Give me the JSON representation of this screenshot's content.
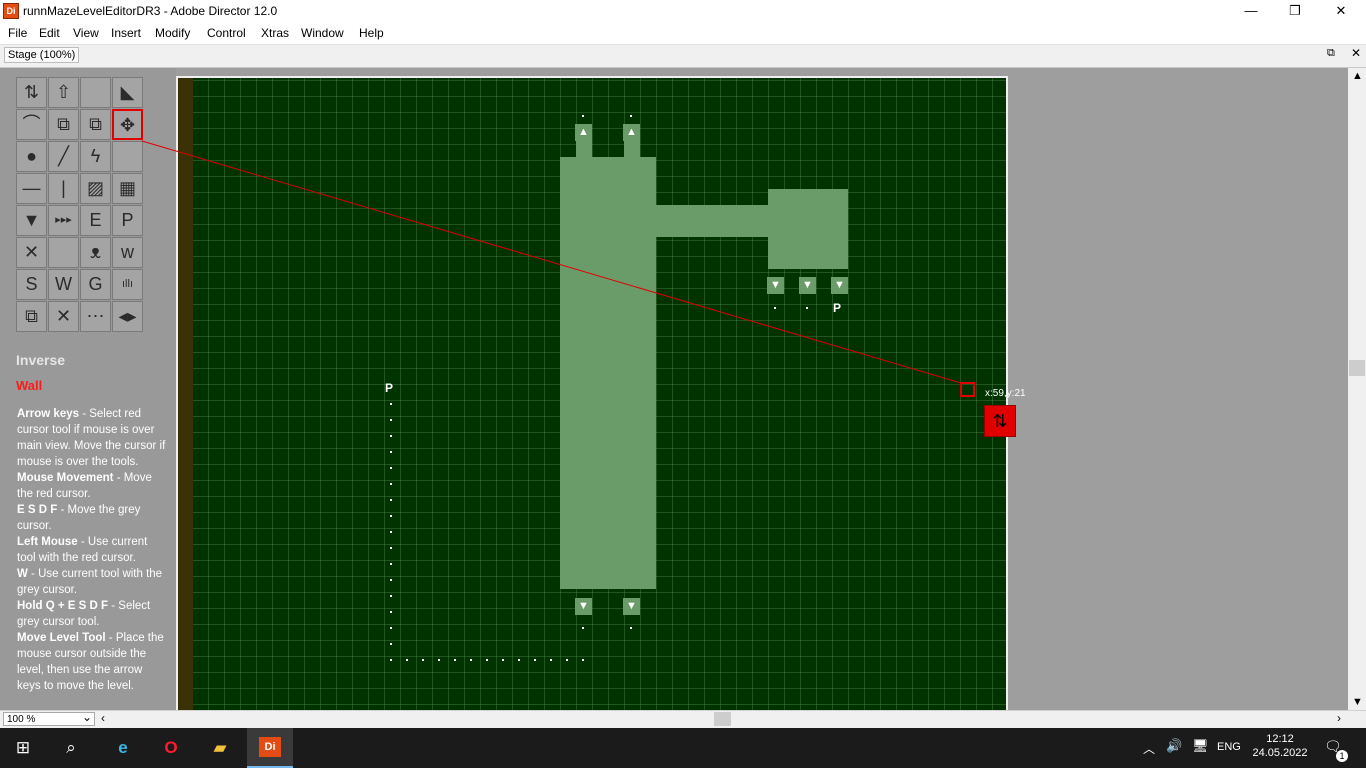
{
  "window": {
    "title": "runnMazeLevelEditorDR3 - Adobe Director 12.0",
    "app_icon_text": "Di",
    "controls": {
      "minimize": "—",
      "maximize": "❐",
      "close": "✕"
    }
  },
  "menu": [
    "File",
    "Edit",
    "View",
    "Insert",
    "Modify",
    "Control",
    "Xtras",
    "Window",
    "Help"
  ],
  "stage_tab": {
    "label": "Stage (100%)"
  },
  "tools": [
    {
      "name": "move-down-tool",
      "glyph": "⇅"
    },
    {
      "name": "move-up-tool",
      "glyph": "⇧"
    },
    {
      "name": "empty-tool",
      "glyph": ""
    },
    {
      "name": "ramp-tool",
      "glyph": "◣"
    },
    {
      "name": "ceiling-tool",
      "glyph": "⌒"
    },
    {
      "name": "copy-tool",
      "glyph": "⧉"
    },
    {
      "name": "duplicate-tool",
      "glyph": "⧉"
    },
    {
      "name": "move-level-tool",
      "glyph": "✥"
    },
    {
      "name": "ball-tool",
      "glyph": "●"
    },
    {
      "name": "line-tool",
      "glyph": "╱"
    },
    {
      "name": "lightning-tool",
      "glyph": "ϟ"
    },
    {
      "name": "blank-tool",
      "glyph": ""
    },
    {
      "name": "horizontal-tool",
      "glyph": "—"
    },
    {
      "name": "vertical-tool",
      "glyph": "|"
    },
    {
      "name": "slope-tool",
      "glyph": "▨"
    },
    {
      "name": "gallery-tool",
      "glyph": "▦"
    },
    {
      "name": "spike-tool",
      "glyph": "▼"
    },
    {
      "name": "dots-tool",
      "glyph": "▸▸▸"
    },
    {
      "name": "e-tool",
      "glyph": "E"
    },
    {
      "name": "p-tool",
      "glyph": "P"
    },
    {
      "name": "bird-left-tool",
      "glyph": "✕"
    },
    {
      "name": "blank-tool-2",
      "glyph": ""
    },
    {
      "name": "bird-tool",
      "glyph": "ᴥ"
    },
    {
      "name": "w-small-tool",
      "glyph": "w"
    },
    {
      "name": "s-tool",
      "glyph": "S"
    },
    {
      "name": "w-tool",
      "glyph": "W"
    },
    {
      "name": "g-tool",
      "glyph": "G"
    },
    {
      "name": "grass-tool",
      "glyph": "ıllı"
    },
    {
      "name": "layers-tool",
      "glyph": "⧉"
    },
    {
      "name": "cross-tool",
      "glyph": "✕"
    },
    {
      "name": "connect-tool",
      "glyph": "⋯"
    },
    {
      "name": "arrows-tool",
      "glyph": "◂▸"
    }
  ],
  "panel": {
    "inverse_label": "Inverse",
    "wall_label": "Wall",
    "help": [
      {
        "key": "Arrow keys",
        "text": " - Select red cursor tool if mouse is over main view. Move the cursor if mouse is over the tools."
      },
      {
        "key": "Mouse Movement",
        "text": " - Move the red cursor."
      },
      {
        "key": "E S D F",
        "text": " - Move the grey cursor."
      },
      {
        "key": "Left Mouse",
        "text": " - Use current tool with the red cursor."
      },
      {
        "key": "W",
        "text": " - Use current tool with the grey cursor."
      },
      {
        "key": "Hold Q + E S D F",
        "text": " - Select grey cursor tool."
      },
      {
        "key": "Move Level Tool",
        "text": " - Place the mouse cursor outside the level, then use the arrow keys to move the level."
      }
    ]
  },
  "maze": {
    "coord_readout": "x:59,y:21",
    "p_marker": "P",
    "up_arrow": "▲",
    "down_arrow": "▼"
  },
  "bottom": {
    "zoom": "100 %",
    "chevron": "⌄"
  },
  "taskbar": {
    "language": "ENG",
    "time": "12:12",
    "date": "24.05.2022",
    "notification_count": "1",
    "icons": {
      "start": "⊞",
      "search": "⌕",
      "edge": "e",
      "opera": "O",
      "explorer": "▰",
      "director": "Di"
    }
  },
  "colors": {
    "maze_bg": "#013300",
    "wall": "#6a9c6a",
    "cursor": "#e00000"
  }
}
